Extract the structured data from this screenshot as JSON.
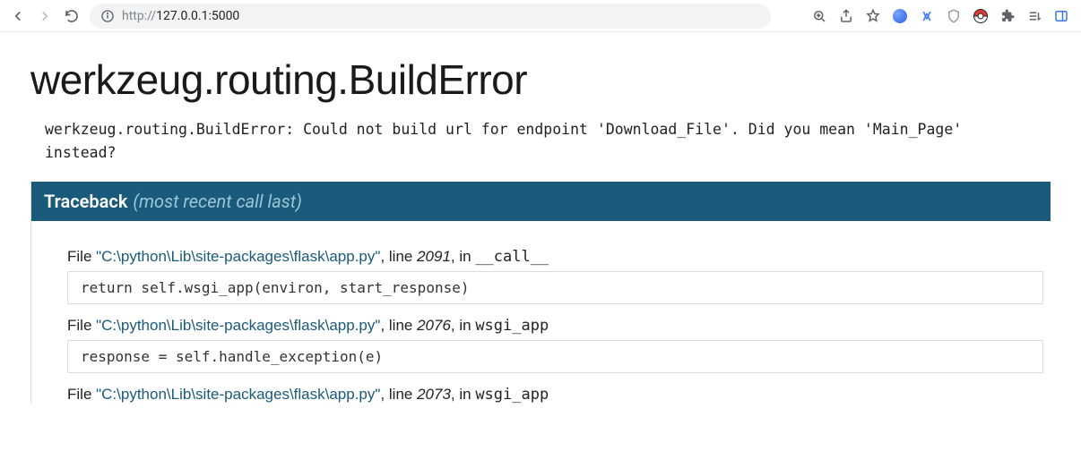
{
  "browser": {
    "url_scheme": "http://",
    "url_rest": "127.0.0.1:5000"
  },
  "error": {
    "exception_class": "werkzeug.routing.BuildError",
    "message": "werkzeug.routing.BuildError: Could not build url for endpoint 'Download_File'. Did you mean 'Main_Page' instead?"
  },
  "traceback": {
    "header_main": "Traceback",
    "header_sub": "(most recent call last)",
    "frames": [
      {
        "file_prefix": "File ",
        "path": "\"C:\\python\\Lib\\site-packages\\flask\\app.py\"",
        "line_prefix": ", line ",
        "line": "2091",
        "in_prefix": ", in ",
        "fn": "__call__",
        "code": "return self.wsgi_app(environ, start_response)"
      },
      {
        "file_prefix": "File ",
        "path": "\"C:\\python\\Lib\\site-packages\\flask\\app.py\"",
        "line_prefix": ", line ",
        "line": "2076",
        "in_prefix": ", in ",
        "fn": "wsgi_app",
        "code": "response = self.handle_exception(e)"
      },
      {
        "file_prefix": "File ",
        "path": "\"C:\\python\\Lib\\site-packages\\flask\\app.py\"",
        "line_prefix": ", line ",
        "line": "2073",
        "in_prefix": ", in ",
        "fn": "wsgi_app",
        "code": ""
      }
    ]
  }
}
